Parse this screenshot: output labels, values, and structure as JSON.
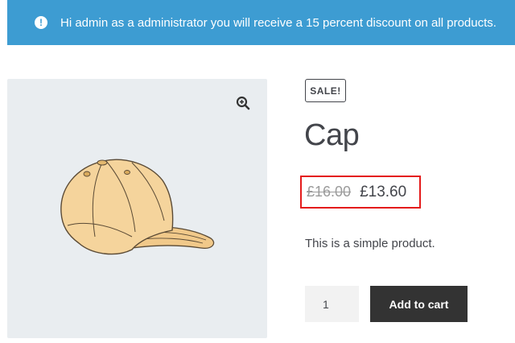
{
  "notice": {
    "icon": "exclamation-icon",
    "text": "Hi admin as a administrator you will receive a 15 percent discount on all products.",
    "color": "#3d9cd2"
  },
  "gallery": {
    "zoom_icon": "zoom-in-icon",
    "image": "cap-product-image"
  },
  "product": {
    "badge": "SALE!",
    "title": "Cap",
    "price_regular": "£16.00",
    "price_sale": "£13.60",
    "short_description": "This is a simple product.",
    "highlight_color": "#e41b1b"
  },
  "cart": {
    "quantity": "1",
    "add_to_cart_label": "Add to cart"
  }
}
